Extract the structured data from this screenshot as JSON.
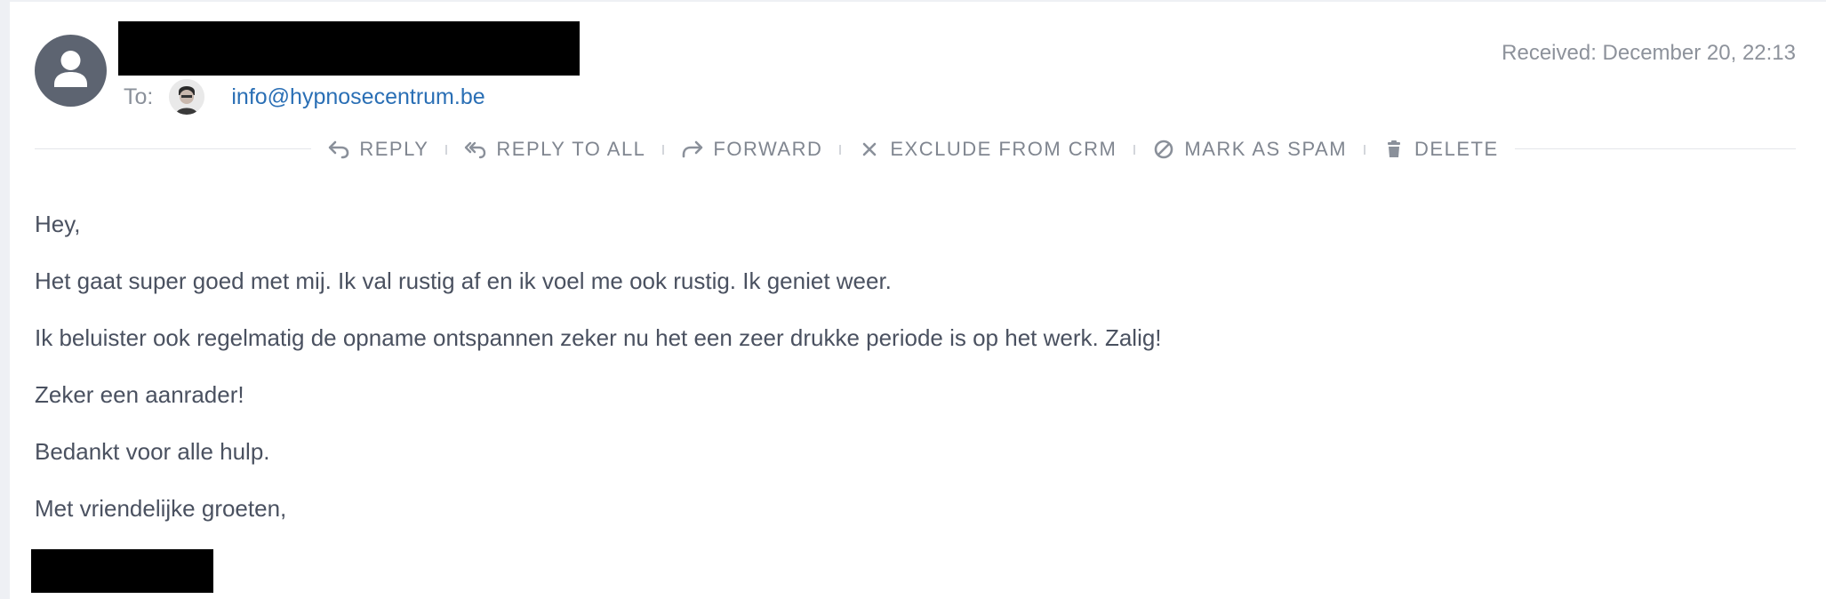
{
  "message": {
    "to_label": "To:",
    "recipient_email": "info@hypnosecentrum.be",
    "received": "Received: December 20, 22:13"
  },
  "toolbar": {
    "actions": [
      {
        "label": "REPLY",
        "icon": "reply-icon"
      },
      {
        "label": "REPLY TO ALL",
        "icon": "reply-all-icon"
      },
      {
        "label": "FORWARD",
        "icon": "forward-icon"
      },
      {
        "label": "EXCLUDE FROM CRM",
        "icon": "close-icon"
      },
      {
        "label": "MARK AS SPAM",
        "icon": "block-icon"
      },
      {
        "label": "DELETE",
        "icon": "trash-icon"
      }
    ]
  },
  "body": {
    "lines": [
      "Hey,",
      "Het gaat super goed met mij. Ik val rustig af en ik voel me ook rustig. Ik geniet weer.",
      "Ik beluister ook regelmatig de opname ontspannen zeker nu het een zeer drukke periode is op het werk. Zalig!",
      "Zeker een aanrader!",
      "Bedankt voor alle hulp.",
      "Met vriendelijke groeten,"
    ]
  },
  "colors": {
    "accent_link": "#2a6fb5",
    "avatar_bg": "#5d6471",
    "toolbar_text": "#808690",
    "body_text": "#4a5160",
    "page_bg": "#eef0f4"
  }
}
